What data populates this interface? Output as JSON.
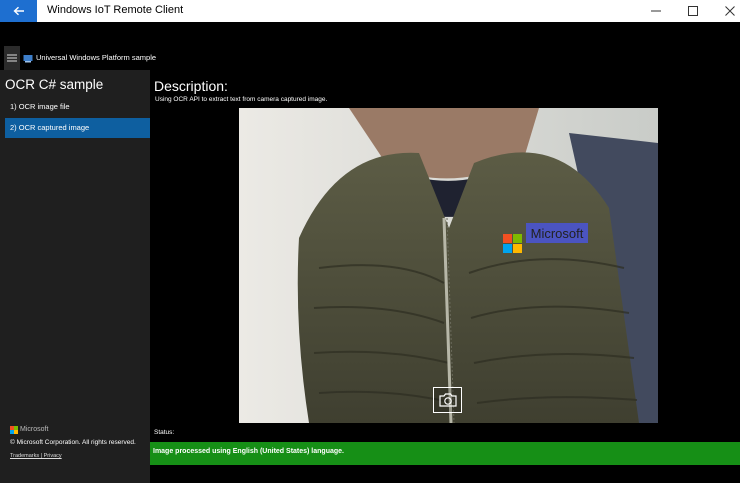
{
  "window": {
    "title": "Windows IoT Remote Client"
  },
  "app": {
    "platform_title": "Universal Windows Platform sample"
  },
  "sidebar": {
    "heading": "OCR C# sample",
    "items": [
      {
        "label": "1) OCR image file",
        "selected": false
      },
      {
        "label": "2) OCR captured image",
        "selected": true
      }
    ],
    "brand": "Microsoft",
    "copyright": "© Microsoft Corporation. All rights reserved.",
    "footer_links": "Trademarks | Privacy"
  },
  "main": {
    "description_heading": "Description:",
    "description_text": "Using OCR API to extract text from camera captured image.",
    "recognized_word": "Microsoft",
    "status_label": "Status:",
    "status_message": "Image processed using English (United States) language."
  },
  "colors": {
    "accent_back_button": "#1e6fd0",
    "nav_selected": "#0e5fa0",
    "status_success": "#168f16",
    "ocr_highlight": "#4a55d8"
  },
  "icons": [
    "back-arrow-icon",
    "minimize-icon",
    "maximize-icon",
    "close-icon",
    "hamburger-icon",
    "platform-icon",
    "microsoft-logo-icon",
    "camera-icon"
  ]
}
